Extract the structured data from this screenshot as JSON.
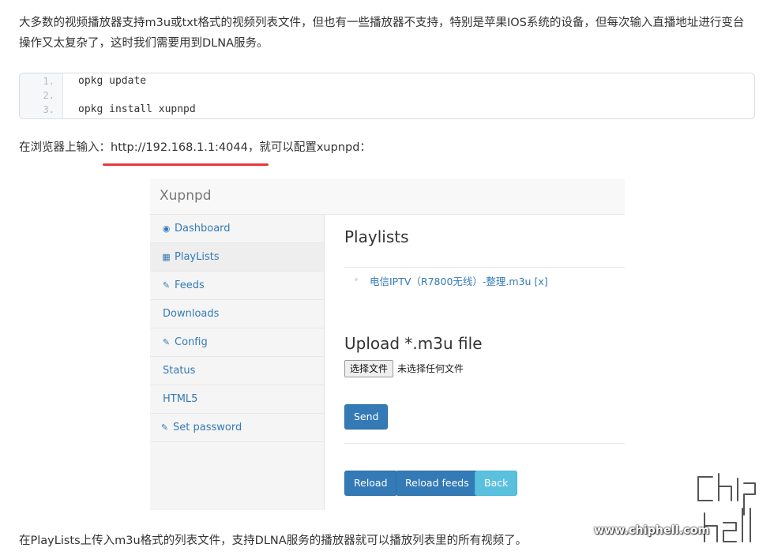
{
  "article": {
    "intro": "大多数的视频播放器支持m3u或txt格式的视频列表文件，但也有一些播放器不支持，特别是苹果IOS系统的设备，但每次输入直播地址进行变台操作又太复杂了，这时我们需要用到DLNA服务。",
    "code_lines": [
      {
        "num": "1.",
        "text": "opkg update"
      },
      {
        "num": "2.",
        "text": ""
      },
      {
        "num": "3.",
        "text": "opkg install xupnpd"
      }
    ],
    "browser_prefix": "在浏览器上输入：",
    "browser_url": "http://192.168.1.1:4044",
    "browser_suffix": "，就可以配置xupnpd：",
    "outro": "在PlayLists上传入m3u格式的列表文件，支持DLNA服务的播放器就可以播放列表里的所有视频了。"
  },
  "xupnpd": {
    "brand": "Xupnpd",
    "sidebar": [
      {
        "label": "Dashboard",
        "icon": "dashboard-icon",
        "glyph": "◉"
      },
      {
        "label": "PlayLists",
        "icon": "table-icon",
        "glyph": "▦"
      },
      {
        "label": "Feeds",
        "icon": "edit-icon",
        "glyph": "✎"
      },
      {
        "label": "Downloads",
        "icon": "",
        "glyph": ""
      },
      {
        "label": "Config",
        "icon": "edit-icon",
        "glyph": "✎"
      },
      {
        "label": "Status",
        "icon": "",
        "glyph": ""
      },
      {
        "label": "HTML5",
        "icon": "",
        "glyph": ""
      },
      {
        "label": "Set password",
        "icon": "edit-icon",
        "glyph": "✎"
      }
    ],
    "playlists_heading": "Playlists",
    "playlist_item": "电信IPTV（R7800无线）-整理.m3u",
    "playlist_delete": "[x]",
    "upload_heading": "Upload *.m3u file",
    "file_button": "选择文件",
    "file_status": "未选择任何文件",
    "send_button": "Send",
    "reload_button": "Reload",
    "reload_feeds_button": "Reload feeds",
    "back_button": "Back"
  },
  "watermark": {
    "site": "www.chiphell.com",
    "logo": "chip hell"
  },
  "colors": {
    "link": "#337ab7",
    "primary": "#337ab7",
    "info": "#5bc0de",
    "underline": "#e8373e"
  }
}
